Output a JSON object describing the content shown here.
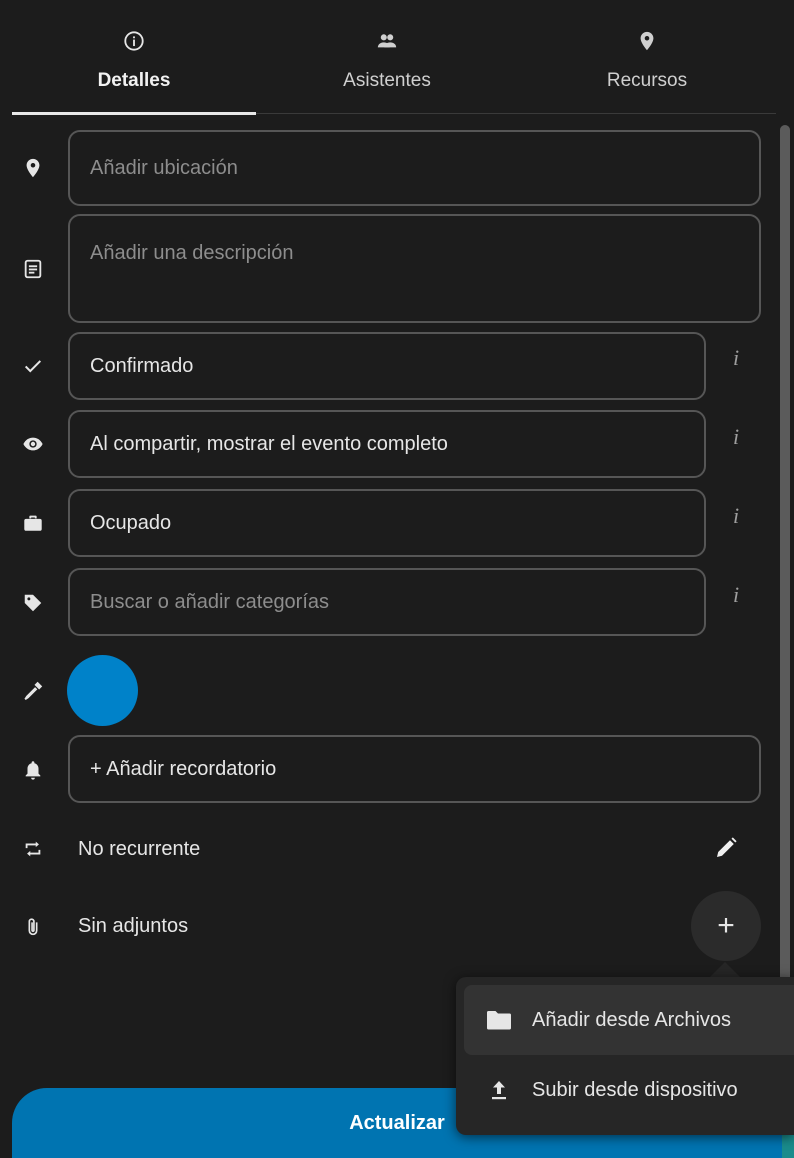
{
  "tabs": [
    {
      "label": "Detalles",
      "icon": "info-icon",
      "active": true
    },
    {
      "label": "Asistentes",
      "icon": "people-icon",
      "active": false
    },
    {
      "label": "Recursos",
      "icon": "map-marker-icon",
      "active": false
    }
  ],
  "fields": {
    "location_placeholder": "Añadir ubicación",
    "description_placeholder": "Añadir una descripción",
    "status_value": "Confirmado",
    "visibility_value": "Al compartir, mostrar el evento completo",
    "availability_value": "Ocupado",
    "categories_placeholder": "Buscar o añadir categorías",
    "reminder_label": "+ Añadir recordatorio"
  },
  "info_symbol": "i",
  "event_color": "#0082c9",
  "recurrence": {
    "label": "No recurrente"
  },
  "attachments": {
    "label": "Sin adjuntos",
    "add_symbol": "+"
  },
  "attachment_menu": [
    {
      "label": "Añadir desde Archivos",
      "icon": "folder-icon"
    },
    {
      "label": "Subir desde dispositivo",
      "icon": "upload-icon"
    }
  ],
  "update_button": {
    "label": "Actualizar"
  }
}
